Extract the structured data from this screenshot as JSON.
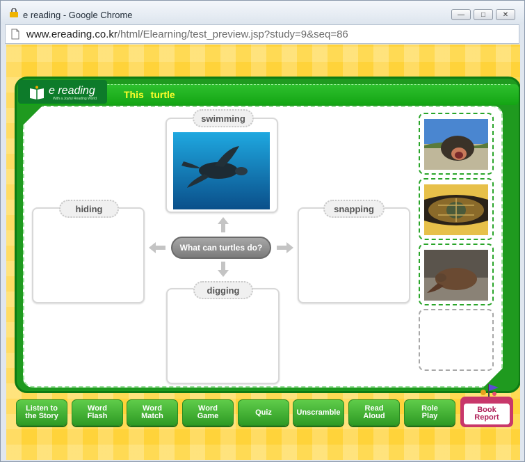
{
  "window": {
    "title": "e reading - Google Chrome",
    "url_host": "www.ereading.co.kr",
    "url_path": "/html/Elearning/test_preview.jsp?study=9&seq=86"
  },
  "app": {
    "logo_text": "e reading",
    "logo_sub": "With a Joyful Reading World",
    "book_title": "This turtle"
  },
  "map": {
    "center_question": "What can turtles do?",
    "cards": {
      "top": "swimming",
      "left": "hiding",
      "right": "snapping",
      "bottom": "digging"
    }
  },
  "images": {
    "slot1": "turtle-snapping-photo",
    "slot2": "turtle-hiding-photo",
    "slot3": "turtle-digging-photo",
    "top_card": "turtle-swimming-photo"
  },
  "nav": [
    {
      "label1": "Listen to",
      "label2": "the Story"
    },
    {
      "label1": "Word",
      "label2": "Flash"
    },
    {
      "label1": "Word",
      "label2": "Match"
    },
    {
      "label1": "Word",
      "label2": "Game"
    },
    {
      "label1": "Quiz",
      "label2": ""
    },
    {
      "label1": "Unscramble",
      "label2": ""
    },
    {
      "label1": "Read",
      "label2": "Aloud"
    },
    {
      "label1": "Role",
      "label2": "Play"
    }
  ],
  "report": {
    "label1": "Book",
    "label2": "Report"
  },
  "colors": {
    "board_green": "#1f9a1f",
    "title_yellow": "#fffd2b",
    "page_yellow": "#ffd84a",
    "report_pink": "#c8376a"
  }
}
